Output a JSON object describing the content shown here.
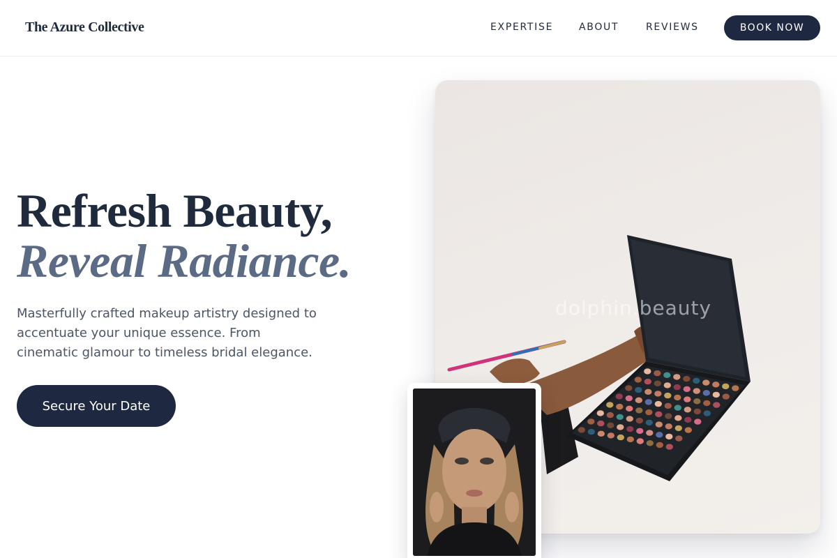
{
  "brand": {
    "name": "The Azure Collective"
  },
  "nav": {
    "links": [
      {
        "label": "EXPERTISE"
      },
      {
        "label": "ABOUT"
      },
      {
        "label": "REVIEWS"
      }
    ],
    "cta_label": "BOOK NOW"
  },
  "hero": {
    "headline_line1": "Refresh Beauty,",
    "headline_line2": "Reveal Radiance.",
    "description": "Masterfully crafted makeup artistry designed to accentuate your unique essence. From cinematic glamour to timeless bridal elegance.",
    "cta_label": "Secure Your Date"
  },
  "images": {
    "main_watermark": "dolphin.beauty"
  },
  "colors": {
    "primary": "#1e2840",
    "accent_italic": "#5c6b85",
    "body_text": "#4b5566"
  }
}
